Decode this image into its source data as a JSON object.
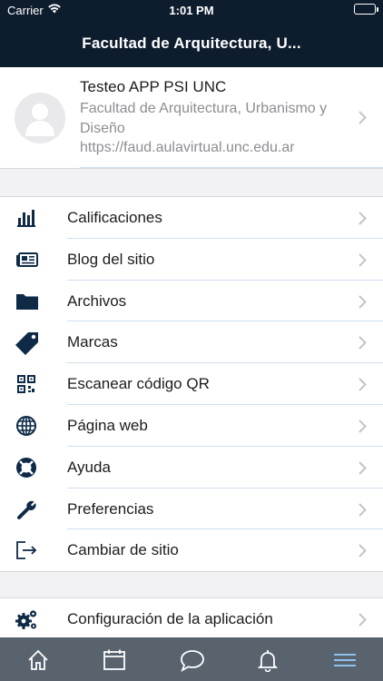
{
  "status_bar": {
    "carrier": "Carrier",
    "time": "1:01 PM"
  },
  "header": {
    "title": "Facultad de Arquitectura, U..."
  },
  "site": {
    "name": "Testeo APP PSI UNC",
    "fullname": "Facultad de Arquitectura, Urbanismo y Diseño",
    "url": "https://faud.aulavirtual.unc.edu.ar"
  },
  "menu": {
    "items": [
      {
        "label": "Calificaciones",
        "icon": "bar-chart-icon"
      },
      {
        "label": "Blog del sitio",
        "icon": "newspaper-icon"
      },
      {
        "label": "Archivos",
        "icon": "folder-icon"
      },
      {
        "label": "Marcas",
        "icon": "tag-icon"
      },
      {
        "label": "Escanear código QR",
        "icon": "qr-code-icon"
      },
      {
        "label": "Página web",
        "icon": "globe-icon"
      },
      {
        "label": "Ayuda",
        "icon": "lifebuoy-icon"
      },
      {
        "label": "Preferencias",
        "icon": "wrench-icon"
      },
      {
        "label": "Cambiar de sitio",
        "icon": "sign-out-icon"
      }
    ]
  },
  "settings": {
    "label": "Configuración de la aplicación",
    "icon": "gears-icon"
  },
  "tabs": [
    {
      "icon": "home-icon"
    },
    {
      "icon": "calendar-icon"
    },
    {
      "icon": "chat-icon"
    },
    {
      "icon": "bell-icon"
    },
    {
      "icon": "menu-icon"
    }
  ],
  "colors": {
    "header_bg": "#0e1d2e",
    "tabbar_bg": "#59636e",
    "active_tab": "#8fc1ec",
    "icon": "#0e2a47"
  }
}
